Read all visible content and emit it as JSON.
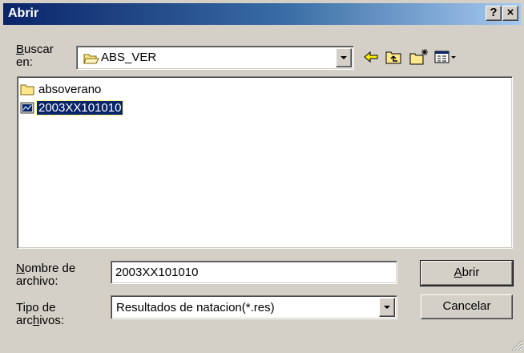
{
  "window": {
    "title": "Abrir",
    "help_label": "?",
    "close_label": "×"
  },
  "lookin": {
    "label_prefix": "",
    "label_mnemonic": "B",
    "label_rest": "uscar",
    "label_line2": "en:",
    "current_folder": "ABS_VER"
  },
  "toolbar": {
    "icons": [
      "back-arrow-icon",
      "up-folder-icon",
      "new-folder-icon",
      "view-menu-icon"
    ]
  },
  "files": [
    {
      "name": "absoverano",
      "type": "folder",
      "selected": false
    },
    {
      "name": "2003XX101010",
      "type": "file",
      "selected": true
    }
  ],
  "filename": {
    "label_mnemonic": "N",
    "label_rest": "ombre de",
    "label_line2": "archivo:",
    "value": "2003XX101010"
  },
  "filetype": {
    "label_line1": "Tipo de",
    "label_pre": "arc",
    "label_mnemonic": "h",
    "label_post": "ivos:",
    "value": "Resultados de natacion(*.res)"
  },
  "buttons": {
    "open_mnemonic": "A",
    "open_rest": "brir",
    "cancel": "Cancelar"
  },
  "colors": {
    "titlebar_start": "#0a246a",
    "titlebar_end": "#a6caf0",
    "face": "#d4d0c8",
    "selection": "#0a246a"
  }
}
